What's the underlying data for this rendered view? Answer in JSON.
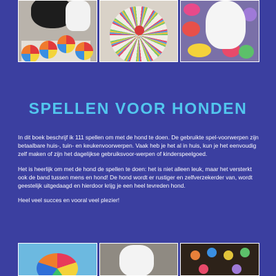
{
  "title": "SPELLEN VOOR HONDEN",
  "paragraphs": [
    "In dit boek beschrijf ik 111 spellen om met de hond te doen. De gebruikte spel-voorwerpen zijn betaalbare huis-, tuin- en keukenvoorwerpen. Vaak heb je het al in huis, kun je het eenvoudig zelf maken of zijn het dagelijkse gebruiksvoor-werpen of kinderspeelgoed.",
    "Het is heerlijk om met de hond de spellen te doen: het is niet alleen leuk, maar het versterkt ook de band tussen mens en hond! De hond wordt er rustiger en zelfverzekerder van, wordt geestelijk uitgedaagd en hierdoor krijg je een heel tevreden hond.",
    "Heel veel succes en vooral veel plezier!"
  ],
  "colors": {
    "background": "#3b3fa0",
    "title": "#52c6ee",
    "text": "#ffffff"
  }
}
